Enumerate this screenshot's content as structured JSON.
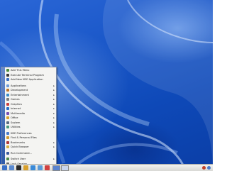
{
  "desktop": {
    "wallpaper": "blue-abstract-swirls"
  },
  "menu": {
    "items": [
      {
        "label": "Add This Menu",
        "icon": "plus-icon",
        "color": "#4b8c3c",
        "submenu": false
      },
      {
        "label": "Execute Terminal Program",
        "icon": "terminal-icon",
        "color": "#3a3a3a",
        "submenu": false
      },
      {
        "label": "Add New KDE Application",
        "icon": "kde-icon",
        "color": "#3b6fc2",
        "submenu": false
      },
      {
        "label": "Applications",
        "icon": "applications-icon",
        "color": "#6f9ad8",
        "submenu": true
      },
      {
        "label": "Development",
        "icon": "development-icon",
        "color": "#c0762c",
        "submenu": true
      },
      {
        "label": "Entertainment",
        "icon": "entertainment-icon",
        "color": "#3a8cc9",
        "submenu": true
      },
      {
        "label": "Games",
        "icon": "games-icon",
        "color": "#7c7c7c",
        "submenu": true
      },
      {
        "label": "Graphics",
        "icon": "graphics-icon",
        "color": "#c93d3d",
        "submenu": true
      },
      {
        "label": "Internet",
        "icon": "internet-icon",
        "color": "#2a6ec6",
        "submenu": true
      },
      {
        "label": "Multimedia",
        "icon": "multimedia-icon",
        "color": "#7a4fb3",
        "submenu": true
      },
      {
        "label": "Office",
        "icon": "office-icon",
        "color": "#d8a22c",
        "submenu": true
      },
      {
        "label": "System",
        "icon": "system-icon",
        "color": "#5a6a80",
        "submenu": true
      },
      {
        "label": "Utilities",
        "icon": "utilities-icon",
        "color": "#4a9a7a",
        "submenu": true
      },
      {
        "label": "KDE Preferences",
        "icon": "preferences-icon",
        "color": "#4a7ac8",
        "submenu": false
      },
      {
        "label": "Find & Personal Files",
        "icon": "search-icon",
        "color": "#d09a30",
        "submenu": false
      },
      {
        "label": "Bookmarks",
        "icon": "bookmarks-icon",
        "color": "#b03a3a",
        "submenu": true
      },
      {
        "label": "Quick Browser",
        "icon": "folder-icon",
        "color": "#d8b040",
        "submenu": true
      },
      {
        "label": "Run Command...",
        "icon": "run-icon",
        "color": "#3a5a9a",
        "submenu": false
      },
      {
        "label": "Switch User",
        "icon": "switch-user-icon",
        "color": "#4a8a4a",
        "submenu": true
      },
      {
        "label": "Lock Session",
        "icon": "lock-icon",
        "color": "#6a6a6a",
        "submenu": false
      },
      {
        "label": "Log Out...",
        "icon": "logout-icon",
        "color": "#c83a3a",
        "submenu": false
      }
    ],
    "separators_after": [
      2,
      12,
      16,
      17
    ]
  },
  "panel": {
    "buttons": [
      {
        "name": "kmenu-button",
        "color": "#3a6fc6"
      },
      {
        "name": "show-desktop-icon",
        "color": "#5a8ad0"
      },
      {
        "name": "terminal-icon",
        "color": "#2a2a2a"
      },
      {
        "name": "home-icon",
        "color": "#d8a02c"
      },
      {
        "name": "browser-icon",
        "color": "#3a8ad8"
      },
      {
        "name": "help-icon",
        "color": "#5a9ad8"
      },
      {
        "name": "mail-icon",
        "color": "#d04040"
      }
    ],
    "pager_desktops": 2,
    "active_desktop": 1,
    "tray": [
      {
        "name": "clipboard-icon",
        "color": "#c0402a"
      },
      {
        "name": "network-icon",
        "color": "#4a7ac8"
      }
    ]
  }
}
